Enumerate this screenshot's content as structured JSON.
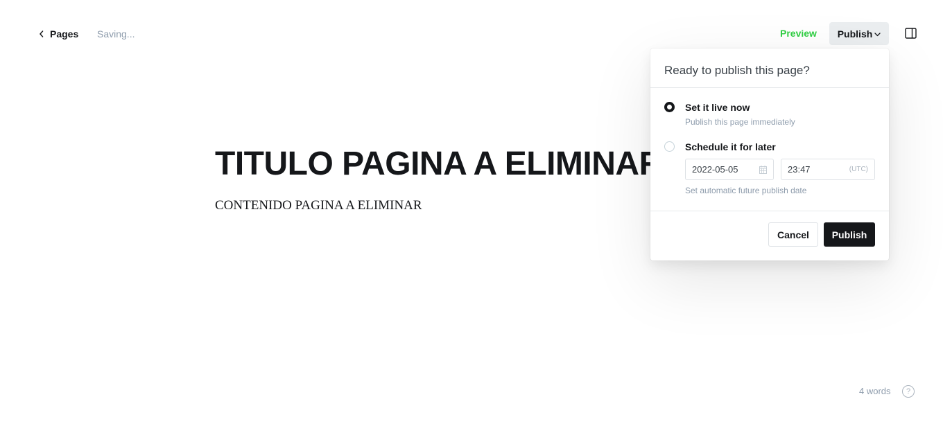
{
  "header": {
    "back_label": "Pages",
    "status": "Saving...",
    "preview_label": "Preview",
    "publish_label": "Publish"
  },
  "editor": {
    "title": "TITULO PAGINA A ELIMINAR",
    "content": "CONTENIDO PAGINA A ELIMINAR"
  },
  "publish_popup": {
    "heading": "Ready to publish this page?",
    "options": [
      {
        "title": "Set it live now",
        "subtitle": "Publish this page immediately",
        "selected": true
      },
      {
        "title": "Schedule it for later",
        "selected": false
      }
    ],
    "schedule": {
      "date": "2022-05-05",
      "time": "23:47",
      "timezone": "(UTC)",
      "hint": "Set automatic future publish date"
    },
    "cancel_label": "Cancel",
    "confirm_label": "Publish"
  },
  "footer": {
    "word_count": "4 words",
    "help_symbol": "?"
  },
  "colors": {
    "accent_green": "#30cf43",
    "primary_dark": "#15171a",
    "muted": "#8e9cac"
  },
  "icons": [
    "chevron-left-icon",
    "chevron-down-icon",
    "sidebar-panel-icon",
    "calendar-icon",
    "help-icon"
  ]
}
